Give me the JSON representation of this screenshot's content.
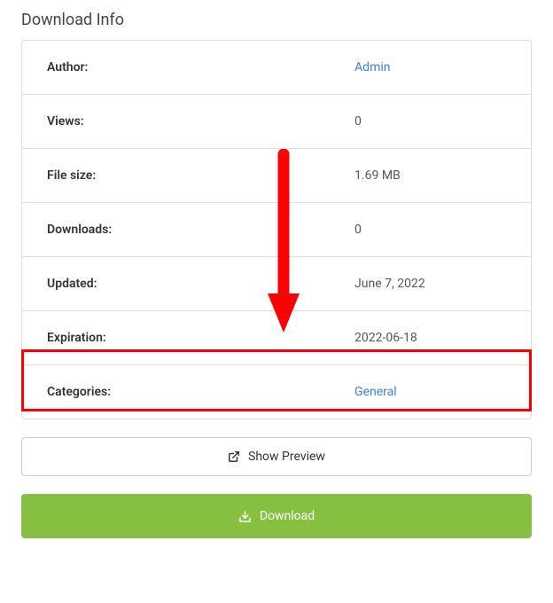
{
  "title": "Download Info",
  "rows": {
    "author": {
      "label": "Author:",
      "value": "Admin",
      "link": true
    },
    "views": {
      "label": "Views:",
      "value": "0",
      "link": false
    },
    "filesize": {
      "label": "File size:",
      "value": "1.69 MB",
      "link": false
    },
    "downloads": {
      "label": "Downloads:",
      "value": "0",
      "link": false
    },
    "updated": {
      "label": "Updated:",
      "value": "June 7, 2022",
      "link": false
    },
    "expiration": {
      "label": "Expiration:",
      "value": "2022-06-18",
      "link": false
    },
    "categories": {
      "label": "Categories:",
      "value": "General",
      "link": true
    }
  },
  "buttons": {
    "preview": "Show Preview",
    "download": "Download"
  },
  "annotation": {
    "highlight_row": "expiration",
    "arrow_color": "#ff0000"
  }
}
